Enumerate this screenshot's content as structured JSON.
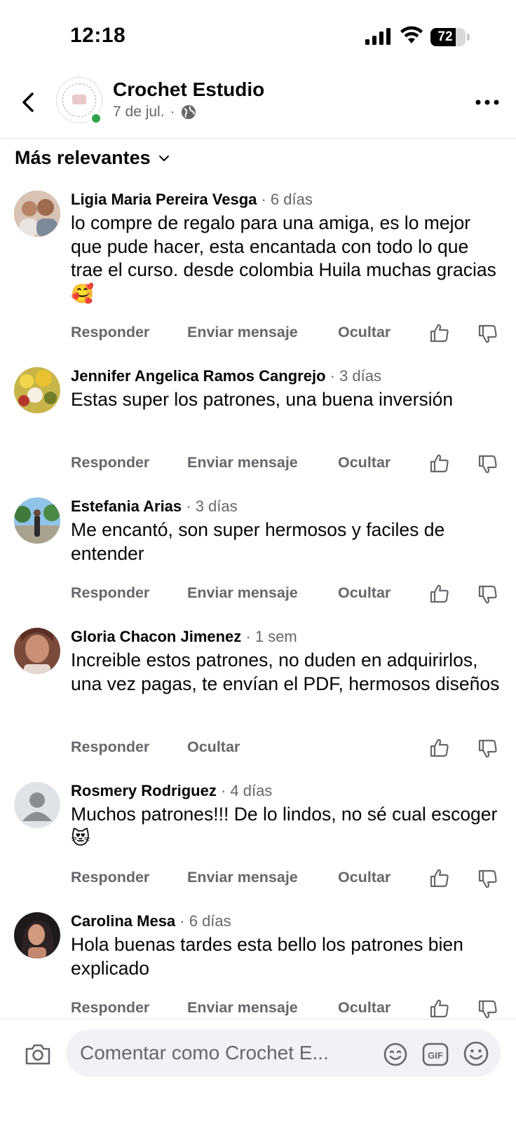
{
  "status_bar": {
    "time": "12:18",
    "battery": "72",
    "battery_level": 0.72
  },
  "header": {
    "page_name": "Crochet Estudio",
    "date": "7 de jul.",
    "separator": "·"
  },
  "sort": {
    "label": "Más relevantes"
  },
  "comments": [
    {
      "name": "Ligia Maria Pereira Vesga",
      "time": " · 6 días",
      "text": "lo compre de regalo para una amiga, es lo mejor que pude hacer, esta encantada con todo lo que trae el curso. desde colombia Huila muchas gracias🥰",
      "actions": [
        "Responder",
        "Enviar mensaje",
        "Ocultar"
      ]
    },
    {
      "name": "Jennifer Angelica Ramos Cangrejo",
      "time": " · 3 días",
      "text": "Estas super los patrones, una buena inversión",
      "actions": [
        "Responder",
        "Enviar mensaje",
        "Ocultar"
      ]
    },
    {
      "name": "Estefania Arias",
      "time": " · 3 días",
      "text": "Me encantó, son super hermosos y faciles de entender",
      "actions": [
        "Responder",
        "Enviar mensaje",
        "Ocultar"
      ]
    },
    {
      "name": "Gloria Chacon Jimenez",
      "time": " · 1 sem",
      "text": "Increible estos patrones, no duden en adquirirlos, una vez pagas, te envían el PDF, hermosos diseños",
      "actions": [
        "Responder",
        "Ocultar"
      ]
    },
    {
      "name": "Rosmery Rodriguez",
      "time": " · 4 días",
      "text": "Muchos patrones!!! De lo lindos, no sé cual escoger😻",
      "actions": [
        "Responder",
        "Enviar mensaje",
        "Ocultar"
      ]
    },
    {
      "name": "Carolina Mesa",
      "time": " · 6 días",
      "text": "Hola buenas tardes esta bello los patrones bien explicado",
      "actions": [
        "Responder",
        "Enviar mensaje",
        "Ocultar"
      ]
    }
  ],
  "composer": {
    "placeholder": "Comentar como Crochet E..."
  },
  "icons": {
    "back": "chevron-left-icon",
    "more": "more-horizontal-icon",
    "globe": "globe-icon",
    "like": "thumbs-up-icon",
    "dislike": "thumbs-down-icon",
    "camera": "camera-icon",
    "avatar_sticker": "avatar-sticker-icon",
    "gif": "gif-icon",
    "emoji": "emoji-icon"
  },
  "colors": {
    "online": "#31a24c",
    "secondary_text": "#65676b",
    "composer_bg": "#f0f2f5"
  }
}
